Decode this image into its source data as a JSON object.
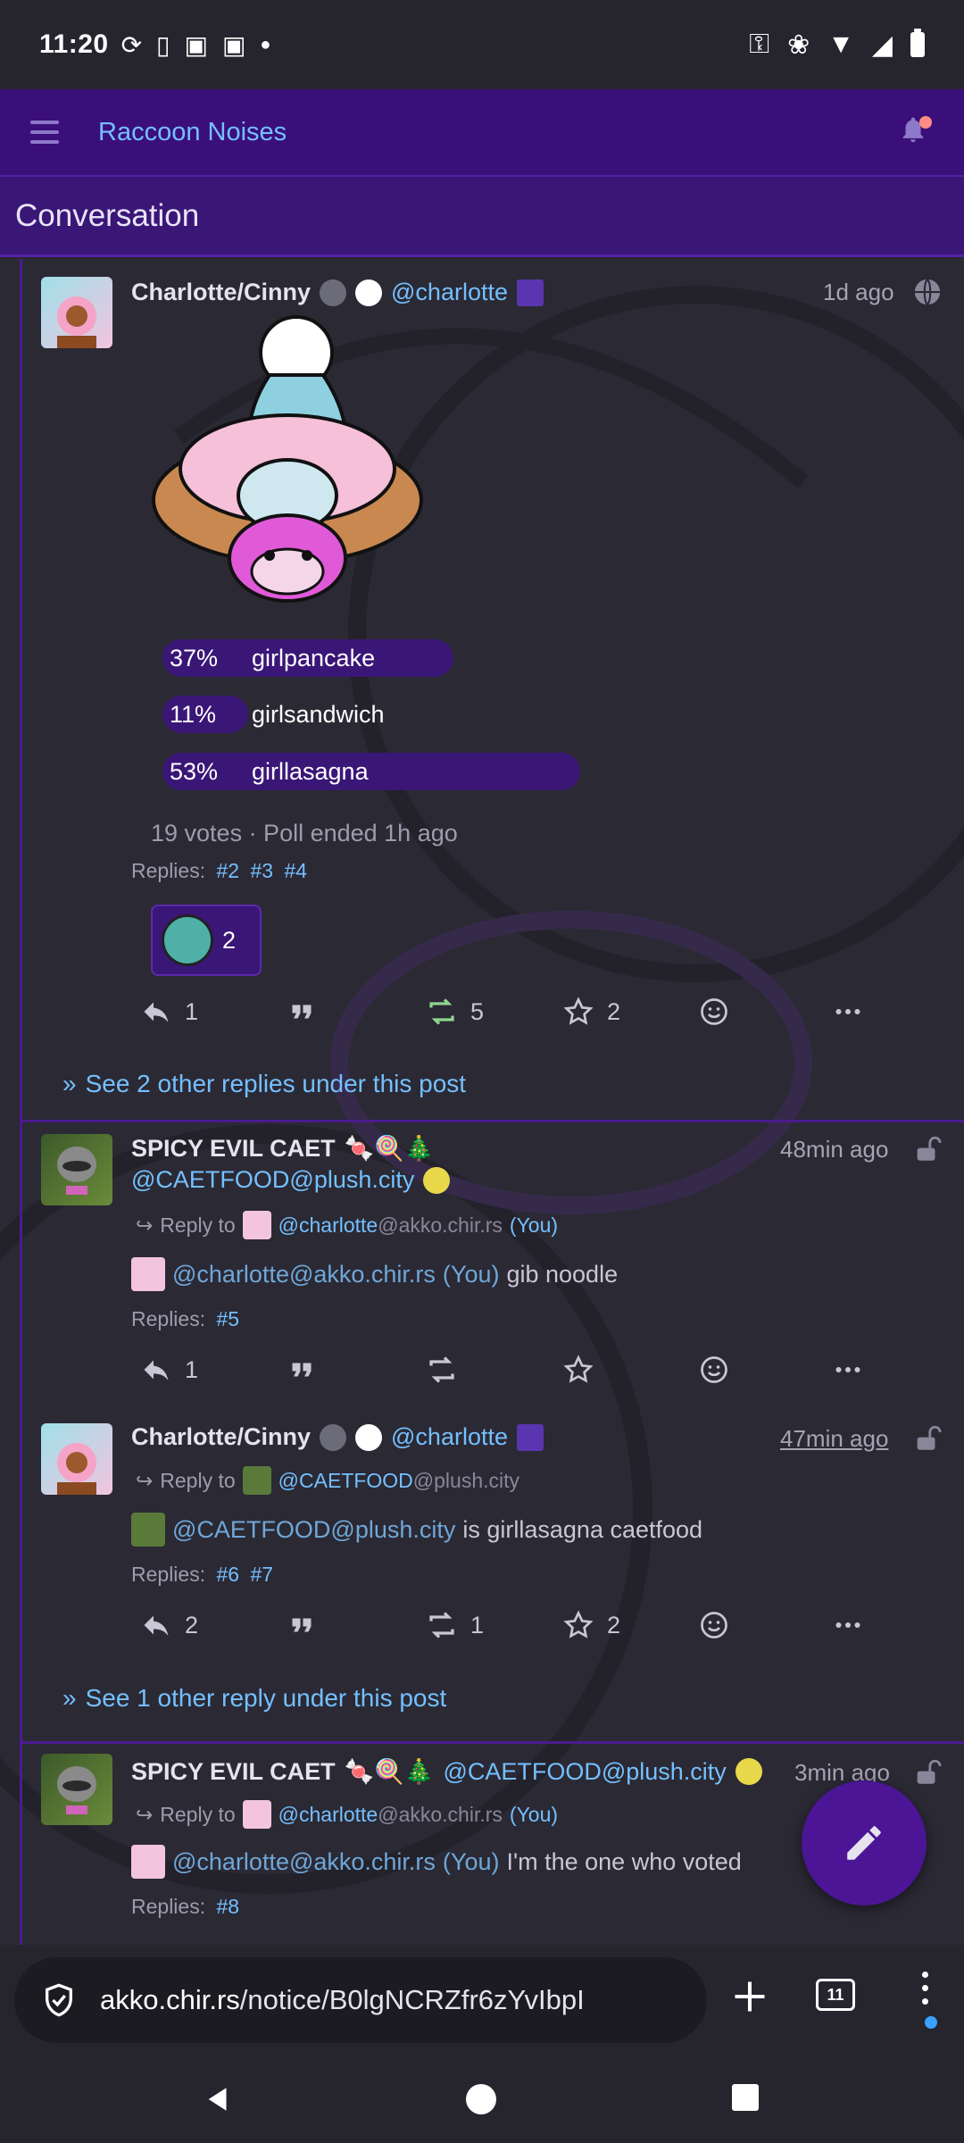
{
  "status": {
    "time": "11:20"
  },
  "app": {
    "title": "Raccoon Noises"
  },
  "conversation": {
    "header": "Conversation"
  },
  "posts": [
    {
      "display_name": "Charlotte/Cinny",
      "handle": "@charlotte",
      "time": "1d ago",
      "poll": {
        "options": [
          {
            "percent": "37%",
            "label": "girlpancake",
            "fraction": 0.37
          },
          {
            "percent": "11%",
            "label": "girlsandwich",
            "fraction": 0.11
          },
          {
            "percent": "53%",
            "label": "girllasagna",
            "fraction": 0.53
          }
        ],
        "meta": "19 votes · Poll ended 1h ago"
      },
      "replies_label": "Replies:",
      "replies": [
        "#2",
        "#3",
        "#4"
      ],
      "reaction_count": "2",
      "actions": {
        "reply": "1",
        "retoot": "5",
        "fav": "2"
      },
      "see_more": "See 2 other replies under this post"
    },
    {
      "display_name": "SPICY EVIL CAET",
      "handle": "@CAETFOOD@plush.city",
      "time": "48min ago",
      "reply_to_label": "Reply to",
      "reply_to_mention": "@charlotte",
      "reply_to_host": "@akko.chir.rs",
      "reply_to_you": "(You)",
      "body_mention": "@charlotte@akko.chir.rs",
      "body_you": "(You)",
      "body_text": "gib noodle",
      "replies_label": "Replies:",
      "replies": [
        "#5"
      ],
      "actions": {
        "reply": "1"
      }
    },
    {
      "display_name": "Charlotte/Cinny",
      "handle": "@charlotte",
      "time": "47min ago",
      "reply_to_label": "Reply to",
      "reply_to_mention": "@CAETFOOD",
      "reply_to_host": "@plush.city",
      "body_mention": "@CAETFOOD@plush.city",
      "body_text": "is girllasagna caetfood",
      "replies_label": "Replies:",
      "replies": [
        "#6",
        "#7"
      ],
      "actions": {
        "reply": "2",
        "retoot": "1",
        "fav": "2"
      },
      "see_more": "See 1 other reply under this post"
    },
    {
      "display_name": "SPICY EVIL CAET",
      "handle": "@CAETFOOD@plush.city",
      "time": "3min ago",
      "reply_to_label": "Reply to",
      "reply_to_mention": "@charlotte",
      "reply_to_host": "@akko.chir.rs",
      "reply_to_you": "(You)",
      "body_mention": "@charlotte@akko.chir.rs",
      "body_you": "(You)",
      "body_text": "I'm the one who voted",
      "replies_label": "Replies:",
      "replies": [
        "#8"
      ]
    }
  ],
  "browser": {
    "url_host": "akko.chir.rs",
    "url_path": "/notice/B0lgNCRZfr6zYvIbpI",
    "tab_count": "11"
  },
  "colors": {
    "accent": "#3b0f7a",
    "link": "#74c0ff",
    "retoot": "#8fd48f"
  }
}
